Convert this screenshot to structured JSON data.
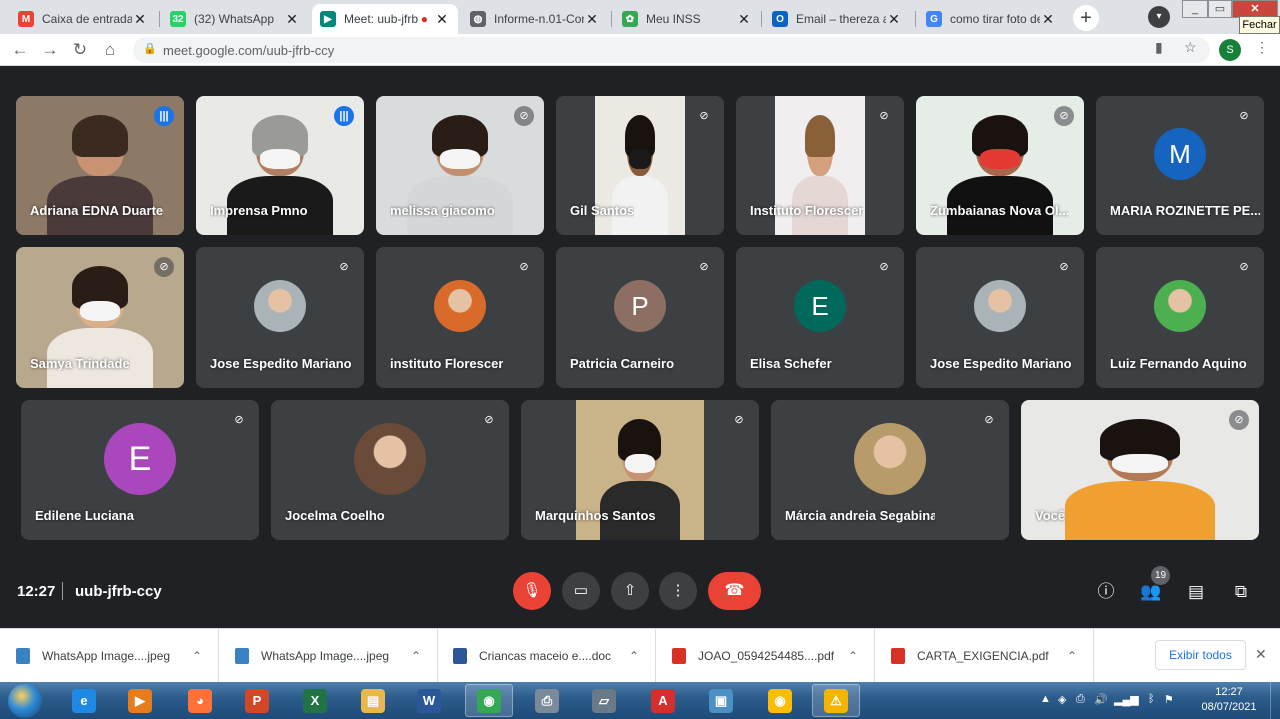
{
  "browser": {
    "tabs": [
      {
        "title": "Caixa de entrada (",
        "icon": "gmail-icon",
        "color": "#ea4335",
        "glyph": "M"
      },
      {
        "title": "(32) WhatsApp",
        "icon": "whatsapp-icon",
        "color": "#25d366",
        "glyph": "32"
      },
      {
        "title": "Meet: uub-jfrb",
        "icon": "meet-icon",
        "color": "#00897b",
        "glyph": "▶",
        "active": true,
        "recording": "●"
      },
      {
        "title": "Informe-n.01-Con",
        "icon": "globe-icon",
        "color": "#5f6368",
        "glyph": "◍"
      },
      {
        "title": "Meu INSS",
        "icon": "inss-icon",
        "color": "#34a853",
        "glyph": "✿"
      },
      {
        "title": "Email – thereza an",
        "icon": "outlook-icon",
        "color": "#0a64c2",
        "glyph": "O"
      },
      {
        "title": "como tirar foto de",
        "icon": "google-icon",
        "color": "#4285f4",
        "glyph": "G"
      }
    ],
    "close_glyph": "✕",
    "new_tab": "+",
    "tooltip": "Fechar",
    "url_host": "meet.google.com",
    "url_path": "/uub-jfrb-ccy",
    "account_initial": "S",
    "win_min": "_",
    "win_max": "▭",
    "win_close": "✕"
  },
  "meet": {
    "time": "12:27",
    "meeting_code": "uub-jfrb-ccy",
    "participants_count": "19",
    "tiles": [
      {
        "name": "Adriana EDNA Duarte",
        "kind": "video",
        "speaking": true,
        "mic": "on",
        "bg": "#8c7a66",
        "person": "#c99272",
        "shirt": "#4a3a3a",
        "hair": "#3a2a20",
        "mask": false
      },
      {
        "name": "Imprensa Pmno",
        "kind": "video",
        "mic": "on",
        "bg": "#e9e9e6",
        "person": "#b07e62",
        "shirt": "#1a1a1a",
        "hair": "#9a9a96",
        "mask": true
      },
      {
        "name": "melissa giacomo",
        "kind": "video",
        "mic": "off",
        "bg": "#d8dcdd",
        "person": "#c29070",
        "shirt": "#d4d6d8",
        "hair": "#2a1d16",
        "mask": true
      },
      {
        "name": "Gil Santos",
        "kind": "video",
        "mic": "off",
        "bg": "#ece9e2",
        "person": "#8a5a3a",
        "shirt": "#f2f2f2",
        "hair": "#1a120e",
        "mask": true,
        "maskColor": "#1a1a1a",
        "narrow": true
      },
      {
        "name": "Instituto Florescer",
        "kind": "video",
        "mic": "off",
        "bg": "#f0eeee",
        "person": "#d4a07e",
        "shirt": "#e5d8d4",
        "hair": "#8a6038",
        "mask": false,
        "narrow": true
      },
      {
        "name": "Zumbaianas Nova Ol...",
        "kind": "video",
        "mic": "off",
        "bg": "#e6ece6",
        "person": "#a9664a",
        "shirt": "#111111",
        "hair": "#1a120e",
        "mask": true,
        "maskColor": "#e53935"
      },
      {
        "name": "MARIA ROZINETTE PE...",
        "kind": "avatar",
        "mic": "off",
        "initial": "M",
        "color": "#1565c0"
      },
      {
        "name": "Samya Trindade",
        "kind": "video",
        "mic": "off",
        "bg": "#b8a88e",
        "person": "#d9b08a",
        "shirt": "#ede7df",
        "hair": "#2a1d16",
        "mask": true
      },
      {
        "name": "Jose Espedito Mariano",
        "kind": "photo",
        "mic": "off",
        "color": "#a9b3b8"
      },
      {
        "name": "instituto Florescer",
        "kind": "photo",
        "mic": "off",
        "color": "#d86a2a"
      },
      {
        "name": "Patricia Carneiro",
        "kind": "avatar",
        "mic": "off",
        "initial": "P",
        "color": "#8d6e63"
      },
      {
        "name": "Elisa Schefer",
        "kind": "avatar",
        "mic": "off",
        "initial": "E",
        "color": "#00695c"
      },
      {
        "name": "Jose Espedito Mariano",
        "kind": "photo",
        "mic": "off",
        "color": "#a9b3b8"
      },
      {
        "name": "Luiz Fernando Aquino",
        "kind": "photo",
        "mic": "off",
        "color": "#4caf50"
      },
      {
        "name": "Edilene Luciana",
        "kind": "avatar",
        "mic": "off",
        "initial": "E",
        "color": "#ab47bc",
        "big": true
      },
      {
        "name": "Jocelma Coelho",
        "kind": "photo",
        "mic": "off",
        "color": "#6a4a38",
        "big": true
      },
      {
        "name": "Marquinhos Santos",
        "kind": "video",
        "mic": "off",
        "bg": "#c9b48a",
        "person": "#c99272",
        "shirt": "#2a2a2a",
        "hair": "#1a120e",
        "mask": true,
        "narrow": true
      },
      {
        "name": "Márcia andreia Segabinazi Schee...",
        "kind": "photo",
        "mic": "off",
        "color": "#b89b6a",
        "big": true
      },
      {
        "name": "Você",
        "kind": "video",
        "mic": "off",
        "bg": "#e8e8e6",
        "person": "#b47a55",
        "shirt": "#f0a030",
        "hair": "#1a120e",
        "mask": true
      }
    ],
    "controls": {
      "mic": "🎙",
      "cam": "▭",
      "present": "⇧",
      "more": "⋮",
      "hangup": "☎"
    },
    "right_icons": {
      "info": "ⓘ",
      "people": "👥",
      "chat": "▤",
      "activities": "⧉"
    }
  },
  "downloads": {
    "items": [
      {
        "name": "WhatsApp Image....jpeg",
        "color": "#3b82c4"
      },
      {
        "name": "WhatsApp Image....jpeg",
        "color": "#3b82c4"
      },
      {
        "name": "Criancas maceio e....doc",
        "color": "#2b579a"
      },
      {
        "name": "JOAO_0594254485....pdf",
        "color": "#d93025"
      },
      {
        "name": "CARTA_EXIGENCIA.pdf",
        "color": "#d93025"
      }
    ],
    "chevron": "⌃",
    "show_all": "Exibir todos",
    "close": "✕"
  },
  "taskbar": {
    "apps": [
      {
        "icon": "ie-icon",
        "glyph": "e",
        "color": "#1e88e5"
      },
      {
        "icon": "media-player-icon",
        "glyph": "▶",
        "color": "#e57c1e"
      },
      {
        "icon": "firefox-icon",
        "glyph": "◕",
        "color": "#ff7139"
      },
      {
        "icon": "powerpoint-icon",
        "glyph": "P",
        "color": "#d24726"
      },
      {
        "icon": "excel-icon",
        "glyph": "X",
        "color": "#217346"
      },
      {
        "icon": "explorer-icon",
        "glyph": "▤",
        "color": "#e8b84a"
      },
      {
        "icon": "word-icon",
        "glyph": "W",
        "color": "#2b579a"
      },
      {
        "icon": "chrome-icon",
        "glyph": "◉",
        "color": "#34a853",
        "active": true
      },
      {
        "icon": "printer-icon",
        "glyph": "⎙",
        "color": "#7a8a99"
      },
      {
        "icon": "scanner-icon",
        "glyph": "▱",
        "color": "#6a7a89"
      },
      {
        "icon": "acrobat-icon",
        "glyph": "A",
        "color": "#d32f2f"
      },
      {
        "icon": "photo-viewer-icon",
        "glyph": "▣",
        "color": "#4a90c4"
      },
      {
        "icon": "chrome-alt-icon",
        "glyph": "◉",
        "color": "#fbbc04"
      },
      {
        "icon": "warning-icon",
        "glyph": "⚠",
        "color": "#f4b400",
        "active": true
      }
    ],
    "time": "12:27",
    "date": "08/07/2021"
  }
}
